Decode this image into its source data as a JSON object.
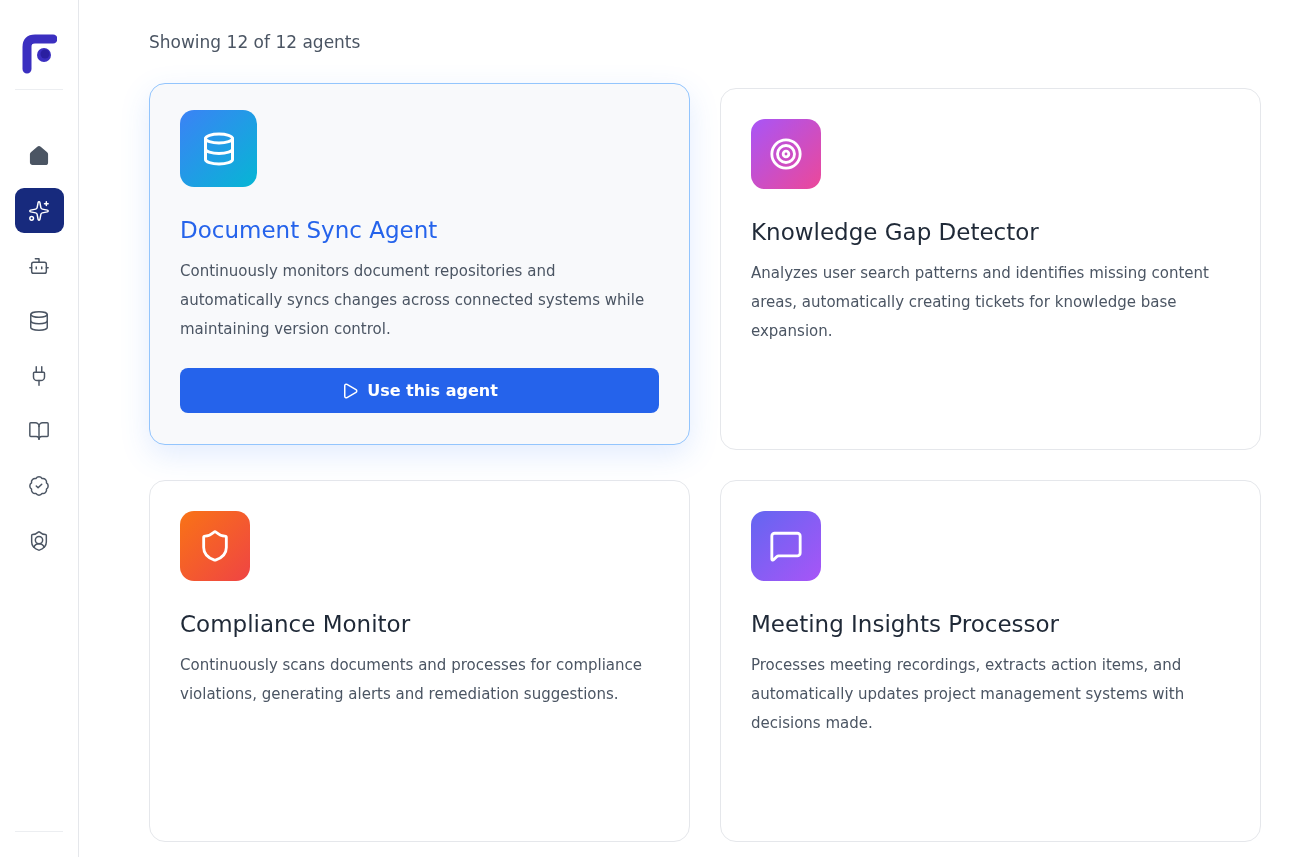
{
  "sidebar": {
    "items": [
      {
        "kind": "home",
        "selected": false
      },
      {
        "kind": "sparkles",
        "selected": true
      },
      {
        "kind": "bot",
        "selected": false
      },
      {
        "kind": "database",
        "selected": false
      },
      {
        "kind": "plug",
        "selected": false
      },
      {
        "kind": "book",
        "selected": false
      },
      {
        "kind": "badge-check",
        "selected": false
      },
      {
        "kind": "shield-user",
        "selected": false
      }
    ]
  },
  "summary": "Showing 12 of 12 agents",
  "agents": [
    {
      "kind": "database",
      "title": "Document Sync Agent",
      "description": "Continuously monitors document repositories and automatically syncs changes across connected systems while maintaining version control.",
      "selected": true,
      "button": "Use this agent"
    },
    {
      "kind": "target",
      "title": "Knowledge Gap Detector",
      "description": "Analyzes user search patterns and identifies missing content areas, automatically creating tickets for knowledge base expansion.",
      "selected": false
    },
    {
      "kind": "shield",
      "title": "Compliance Monitor",
      "description": "Continuously scans documents and processes for compliance violations, generating alerts and remediation suggestions.",
      "selected": false
    },
    {
      "kind": "message",
      "title": "Meeting Insights Processor",
      "description": "Processes meeting recordings, extracts action items, and automatically updates project management systems with decisions made.",
      "selected": false
    }
  ]
}
